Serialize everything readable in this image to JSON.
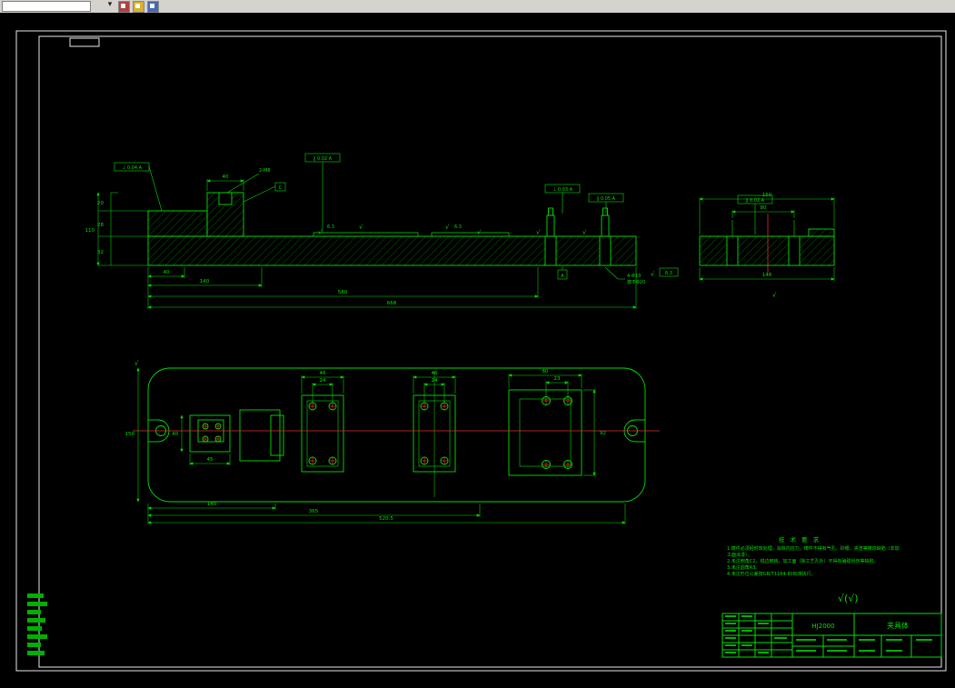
{
  "colors": {
    "canvas_bg": "#000000",
    "line_green": "#00e000",
    "hatch_green": "#00a000",
    "centerline_red": "#e03030",
    "frame_white": "#e8e8e8",
    "toolbar_bg": "#d6d3ce"
  },
  "toolbar": {
    "layer_combobox_value": "",
    "icons": [
      {
        "name": "dropdown-arrow-icon",
        "glyph": "▾"
      },
      {
        "name": "modify-icon",
        "color": "#b04040"
      },
      {
        "name": "open-folder-icon",
        "color": "#d8b030"
      },
      {
        "name": "save-icon",
        "color": "#4868b0"
      }
    ]
  },
  "drawing": {
    "symbols": {
      "check": "√",
      "surface_note": "√(√)"
    },
    "gdt": {
      "f1": "⊥ 0.04 A",
      "f2": "∥ 0.02 A",
      "f3": "⊥ 0.03 A",
      "f4": "∥ 0.05 A",
      "f5": "∥ 0.02 A",
      "datum_a": "A",
      "datum_c": "C",
      "thread_note": "2-M8",
      "hole_note1": "4-Φ13",
      "hole_note2": "锪平Φ20",
      "ra1": "6.3",
      "ra2": "6.3",
      "ra3": "6.3"
    },
    "dims": {
      "front_b1": "40",
      "front_b2": "140",
      "front_b3": "580",
      "front_b4": "668",
      "front_l1": "20",
      "front_l2": "28",
      "front_l3": "32",
      "front_l4": "110",
      "boss_top": "40",
      "right_t1": "80",
      "right_t2": "150",
      "right_b1": "148",
      "plan_b1": "140",
      "plan_b2": "365",
      "plan_b3": "520.5",
      "plan_l1": "150",
      "pad1_t1": "24",
      "pad1_t2": "46",
      "pad2_t1": "24",
      "pad2_t2": "46",
      "pad3_t1": "23",
      "pad3_t2": "80",
      "pad3_r1": "92",
      "cluster_b1": "45",
      "cluster_l1": "40"
    },
    "tech_notes": {
      "title": "技 术 要 求",
      "lines": [
        "1.铸件必须经时效处理，消除内应力，铸件不得有气孔、砂眼、夹渣等铸造缺陷（非加",
        "工面涂漆）。",
        "2.未注倒角C2，锐边倒钝，加工面（除工艺孔外）不得有磕碰划伤等缺陷。",
        "3.未注圆角R3。",
        "4.未注形位公差按GB/T1184-80标准执行。"
      ]
    },
    "title_block": {
      "code": "HJ2000",
      "part_name": "夹具体"
    }
  }
}
